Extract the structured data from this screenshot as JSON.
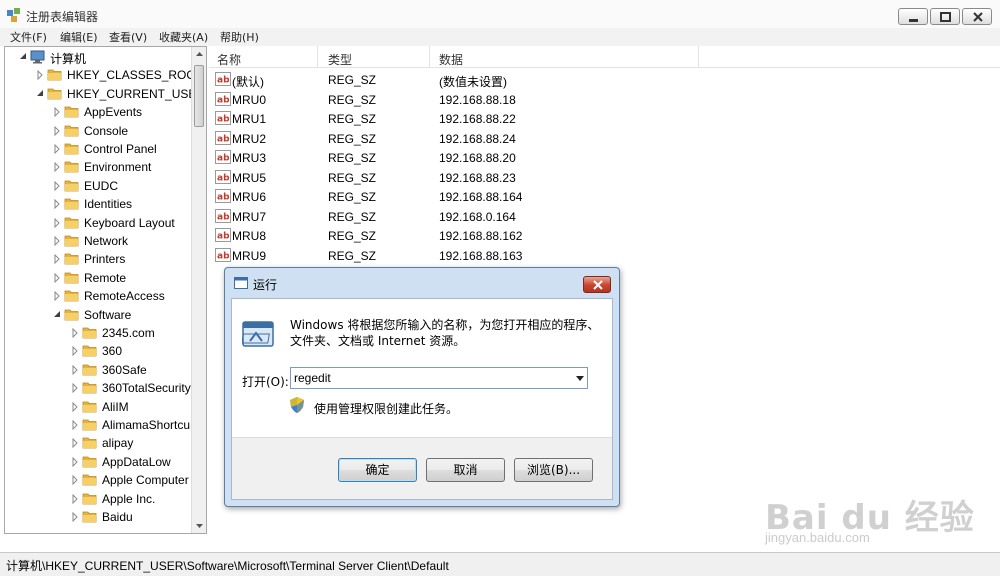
{
  "window": {
    "title": "注册表编辑器"
  },
  "menu": [
    "文件(F)",
    "编辑(E)",
    "查看(V)",
    "收藏夹(A)",
    "帮助(H)"
  ],
  "tree": {
    "root": "计算机",
    "items": [
      {
        "label": "HKEY_CLASSES_ROOT",
        "expanded": false
      },
      {
        "label": "HKEY_CURRENT_USER",
        "expanded": true
      },
      {
        "label": "AppEvents"
      },
      {
        "label": "Console"
      },
      {
        "label": "Control Panel"
      },
      {
        "label": "Environment"
      },
      {
        "label": "EUDC"
      },
      {
        "label": "Identities"
      },
      {
        "label": "Keyboard Layout"
      },
      {
        "label": "Network"
      },
      {
        "label": "Printers"
      },
      {
        "label": "Remote"
      },
      {
        "label": "RemoteAccess"
      },
      {
        "label": "Software",
        "expanded": true
      },
      {
        "label": "2345.com"
      },
      {
        "label": "360"
      },
      {
        "label": "360Safe"
      },
      {
        "label": "360TotalSecurity"
      },
      {
        "label": "AliIM"
      },
      {
        "label": "AlimamaShortcu"
      },
      {
        "label": "alipay"
      },
      {
        "label": "AppDataLow"
      },
      {
        "label": "Apple Computer"
      },
      {
        "label": "Apple Inc."
      },
      {
        "label": "Baidu"
      }
    ]
  },
  "list": {
    "columns": [
      "名称",
      "类型",
      "数据"
    ],
    "rows": [
      {
        "name": "(默认)",
        "type": "REG_SZ",
        "data": "(数值未设置)"
      },
      {
        "name": "MRU0",
        "type": "REG_SZ",
        "data": "192.168.88.18"
      },
      {
        "name": "MRU1",
        "type": "REG_SZ",
        "data": "192.168.88.22"
      },
      {
        "name": "MRU2",
        "type": "REG_SZ",
        "data": "192.168.88.24"
      },
      {
        "name": "MRU3",
        "type": "REG_SZ",
        "data": "192.168.88.20"
      },
      {
        "name": "MRU5",
        "type": "REG_SZ",
        "data": "192.168.88.23"
      },
      {
        "name": "MRU6",
        "type": "REG_SZ",
        "data": "192.168.88.164"
      },
      {
        "name": "MRU7",
        "type": "REG_SZ",
        "data": "192.168.0.164"
      },
      {
        "name": "MRU8",
        "type": "REG_SZ",
        "data": "192.168.88.162"
      },
      {
        "name": "MRU9",
        "type": "REG_SZ",
        "data": "192.168.88.163"
      }
    ]
  },
  "status": "计算机\\HKEY_CURRENT_USER\\Software\\Microsoft\\Terminal Server Client\\Default",
  "run_dialog": {
    "title": "运行",
    "description": "Windows 将根据您所输入的名称，为您打开相应的程序、文件夹、文档或 Internet 资源。",
    "open_label": "打开(O):",
    "open_value": "regedit",
    "admin_note": "使用管理权限创建此任务。",
    "ok_label": "确定",
    "cancel_label": "取消",
    "browse_label": "浏览(B)..."
  },
  "watermark": {
    "logo": "Bai du 经验",
    "sub": "jingyan.baidu.com"
  },
  "icons": {
    "folder": "folder-icon",
    "string_value": "reg-sz-icon",
    "computer": "computer-icon",
    "shield": "uac-shield-icon",
    "run": "run-icon"
  },
  "colors": {
    "dialog_frame": "#cfe0f3",
    "close_red": "#c74430",
    "folder_yellow": "#f1c453"
  }
}
